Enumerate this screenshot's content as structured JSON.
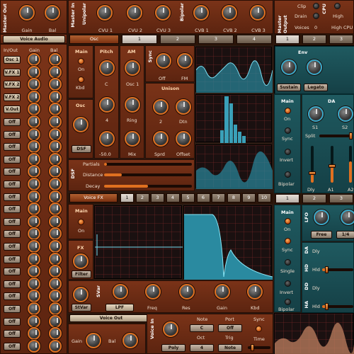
{
  "top": {
    "master_out_title": "Master Out",
    "gain_label": "Gain",
    "bal_label": "Bal",
    "master_in_title": "Master In",
    "unipolar_label": "Unipolar",
    "cvu_labels": [
      "CVU 1",
      "CVU 2",
      "CVU 3"
    ],
    "bipolar_label": "Bipolar",
    "cvb_labels": [
      "CVB 1",
      "CVB 2",
      "CVB 3"
    ],
    "master_output_title": "Master Output",
    "clip_label": "Clip",
    "drain_label": "Drain",
    "voices_label": "Voices",
    "voices_value": "0",
    "cpu_title": "CPU",
    "high_label": "High",
    "high_cpu_label": "High CPU"
  },
  "voice_audio": {
    "title": "Voice Audio",
    "col_inout": "In/Out",
    "col_gain": "Gain",
    "col_bal": "Bal",
    "rows": [
      "Osc 1",
      "V.FX 1",
      "V.FX 2",
      "V.FX 2",
      "V.Out",
      "Off",
      "Off",
      "Off",
      "Off",
      "Off",
      "Off",
      "Off",
      "Off",
      "Off",
      "Off",
      "Off",
      "Off",
      "Off",
      "Off",
      "Off",
      "Off",
      "Off",
      "Off",
      "Off"
    ],
    "side_label": "Master Out"
  },
  "osc": {
    "title": "Osc",
    "tabs": [
      "1",
      "2",
      "3",
      "4"
    ],
    "main_title": "Main",
    "on_label": "On",
    "kbd_label": "Kbd",
    "pitch_title": "Pitch",
    "c_label": "C",
    "pitch_value": "4",
    "pitch_fine": "-50.0",
    "am_title": "AM",
    "osc1_label": "Osc 1",
    "ring_label": "Ring",
    "mix_label": "Mix",
    "sync_title": "Sync",
    "off_label": "Off",
    "fm_label": "FM",
    "unison_title": "Unison",
    "unison_count": "2",
    "dtn_label": "Dtn",
    "sprd_label": "Sprd",
    "offset_label": "Offset",
    "osc_title": "Osc",
    "dsf_label": "DSF",
    "dsf_title": "DSF",
    "partials_label": "Partials",
    "distance_label": "Distance",
    "decay_label": "Decay"
  },
  "sliders": {
    "partials": 0.03,
    "distance": 0.2,
    "decay": 0.5
  },
  "voice_fx": {
    "title": "Voice FX",
    "tabs": [
      "1",
      "2",
      "3",
      "4",
      "5",
      "6",
      "7",
      "8",
      "9",
      "10"
    ],
    "main_title": "Main",
    "on_label": "On",
    "fx_title": "FX",
    "filter_label": "Filter",
    "svar_title": "SVar",
    "svar_btn": "StVar",
    "lpf_label": "LPF",
    "freq_label": "Freq",
    "res_label": "Res",
    "gain_label": "Gain",
    "kbd_label": "Kbd"
  },
  "voice_out": {
    "title": "Voice Out",
    "gain_label": "Gain",
    "bal_label": "Bal",
    "voice_in_title": "Voice In",
    "note_label": "Note",
    "note_value": "C",
    "oct_label": "Oct",
    "oct_value": "4",
    "poly_label": "Poly",
    "port_label": "Port",
    "port_value": "Off",
    "trig_label": "Trig",
    "trig_value": "Note",
    "sync_label": "Sync",
    "time_label": "Time"
  },
  "right": {
    "tabs": [
      "1",
      "2",
      "3"
    ],
    "env_title": "Env",
    "sustain_label": "Sustain",
    "legato_label": "Legato",
    "main_title": "Main",
    "on_label": "On",
    "sync_label": "Sync",
    "invert_label": "Invert",
    "bipolar_label": "Bipolar",
    "da_title": "DA",
    "s1_label": "S1",
    "s2_label": "S2",
    "split_label": "Split",
    "dly_label": "Dly",
    "a1_label": "A1",
    "a2_label": "A2",
    "lfo_tabs": [
      "1",
      "2",
      "3"
    ],
    "lfo_title": "LFO",
    "single_label": "Single",
    "free_label": "Free",
    "rate_label": "1/4",
    "da_label": "DA",
    "hd_label": "HD",
    "dd_label": "DD",
    "ha_label": "HA",
    "dly2_label": "Dly",
    "hld_label": "Hld",
    "dly3_label": "Dly",
    "hld2_label": "Hld"
  },
  "colors": {
    "accent": "#e07020",
    "brown_panel": "#6a2a12",
    "teal_panel": "#1a4a50"
  }
}
